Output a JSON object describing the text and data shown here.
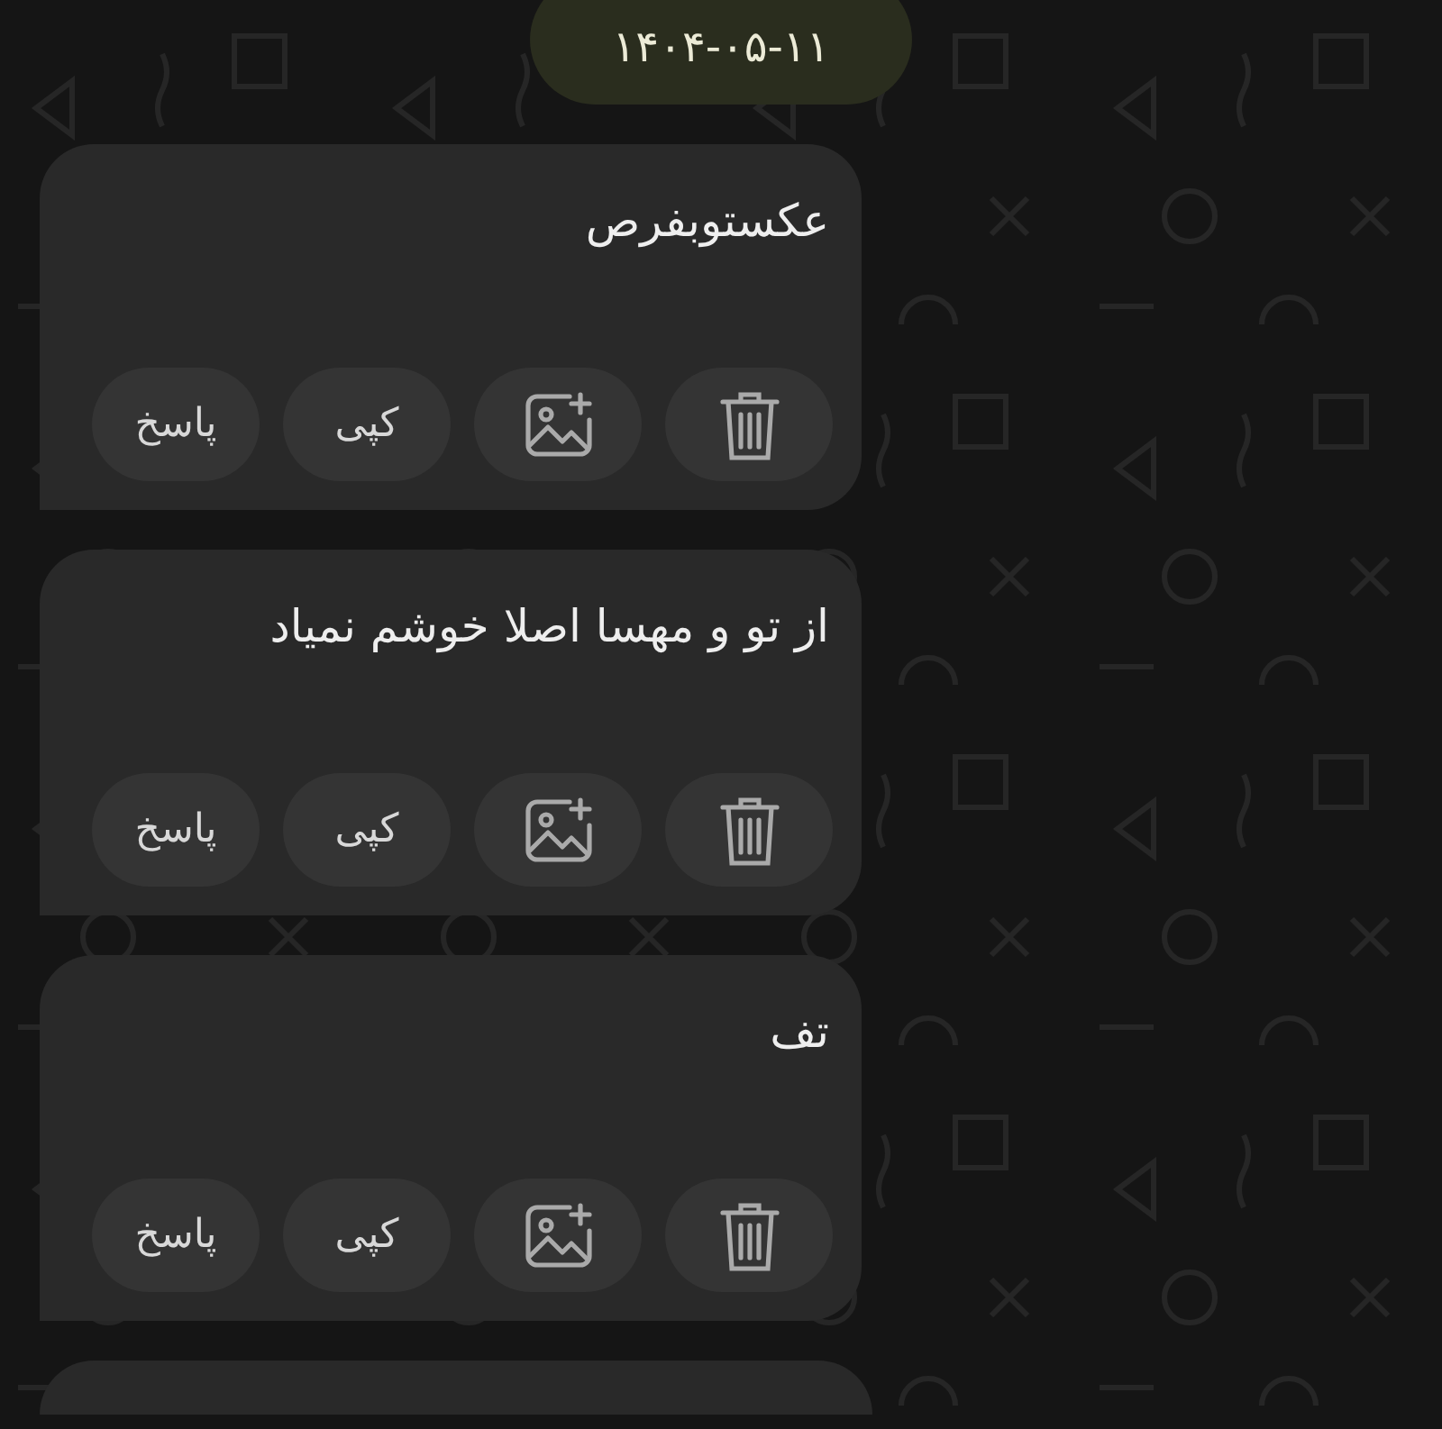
{
  "date_badge": "۱۴۰۴-۰۵-۱۱",
  "messages": [
    {
      "text": "عکستوبفرص",
      "actions": [
        {
          "kind": "delete"
        },
        {
          "kind": "add-image"
        },
        {
          "kind": "text",
          "label": "کپی"
        },
        {
          "kind": "text",
          "label": "پاسخ"
        }
      ]
    },
    {
      "text": "از تو و مهسا اصلا خوشم نمیاد",
      "actions": [
        {
          "kind": "delete"
        },
        {
          "kind": "add-image"
        },
        {
          "kind": "text",
          "label": "کپی"
        },
        {
          "kind": "text",
          "label": "پاسخ"
        }
      ]
    },
    {
      "text": "تف",
      "actions": [
        {
          "kind": "delete"
        },
        {
          "kind": "add-image"
        },
        {
          "kind": "text",
          "label": "کپی"
        },
        {
          "kind": "text",
          "label": "پاسخ"
        }
      ]
    }
  ]
}
